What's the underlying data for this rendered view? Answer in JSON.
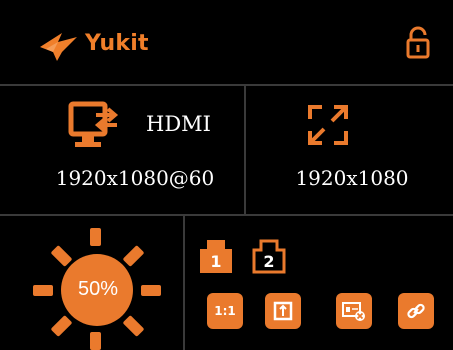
{
  "colors": {
    "accent": "#ea7a2d",
    "background": "#000000",
    "divider": "#3a3a3a",
    "text": "#ffffff"
  },
  "header": {
    "brand": "Yukit",
    "lock_icon": "unlocked-padlock-icon"
  },
  "source": {
    "icon": "monitor-input-icon",
    "label": "HDMI",
    "resolution": "1920x1080@60"
  },
  "output": {
    "icon": "fullscreen-icon",
    "resolution": "1920x1080"
  },
  "brightness": {
    "value": "50%",
    "level": 0.5
  },
  "channels": [
    {
      "label": "1",
      "active": true
    },
    {
      "label": "2",
      "active": false
    }
  ],
  "actions": [
    {
      "id": "scale",
      "label": "1:1"
    },
    {
      "id": "rotate",
      "icon": "rotate-screen-icon"
    },
    {
      "id": "disconnect",
      "icon": "card-disconnect-icon"
    },
    {
      "id": "link",
      "icon": "link-icon"
    }
  ]
}
